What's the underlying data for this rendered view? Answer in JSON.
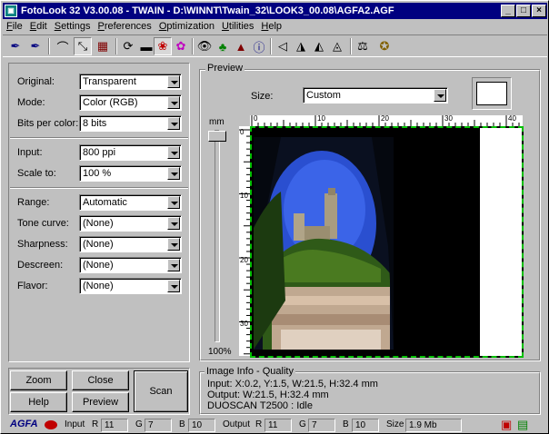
{
  "window": {
    "title": "FotoLook 32 V3.00.08 - TWAIN - D:\\WINNT\\Twain_32\\LOOK3_00.08\\AGFA2.AGF"
  },
  "menu": [
    "File",
    "Edit",
    "Settings",
    "Preferences",
    "Optimization",
    "Utilities",
    "Help"
  ],
  "settings": {
    "original": {
      "label": "Original:",
      "value": "Transparent"
    },
    "mode": {
      "label": "Mode:",
      "value": "Color (RGB)"
    },
    "bits": {
      "label": "Bits per color:",
      "value": "8 bits"
    },
    "input": {
      "label": "Input:",
      "value": "800 ppi"
    },
    "scale": {
      "label": "Scale to:",
      "value": "100 %"
    },
    "range": {
      "label": "Range:",
      "value": "Automatic"
    },
    "tone": {
      "label": "Tone curve:",
      "value": "(None)"
    },
    "sharpness": {
      "label": "Sharpness:",
      "value": "(None)"
    },
    "descreen": {
      "label": "Descreen:",
      "value": "(None)"
    },
    "flavor": {
      "label": "Flavor:",
      "value": "(None)"
    }
  },
  "buttons": {
    "zoom": "Zoom",
    "close": "Close",
    "help": "Help",
    "preview": "Preview",
    "scan": "Scan"
  },
  "preview": {
    "title": "Preview",
    "size_label": "Size:",
    "size_value": "Custom",
    "unit": "mm",
    "zoom_pct": "100%",
    "ruler_top": [
      "0",
      "10",
      "20",
      "30",
      "40"
    ],
    "ruler_left": [
      "0",
      "10",
      "20",
      "30"
    ]
  },
  "info": {
    "title": "Image Info - Quality",
    "input_line": "Input: X:0.2, Y:1.5, W:21.5, H:32.4 mm",
    "output_line": "Output: W:21.5, H:32.4 mm",
    "device_line": "DUOSCAN T2500 : Idle"
  },
  "status": {
    "brand": "AGFA",
    "input_label": "Input",
    "input_r": "11",
    "input_g": "7",
    "input_b": "10",
    "output_label": "Output",
    "output_r": "11",
    "output_g": "7",
    "output_b": "10",
    "r": "R",
    "g": "G",
    "b": "B",
    "size_label": "Size",
    "size_value": "1.9 Mb"
  }
}
